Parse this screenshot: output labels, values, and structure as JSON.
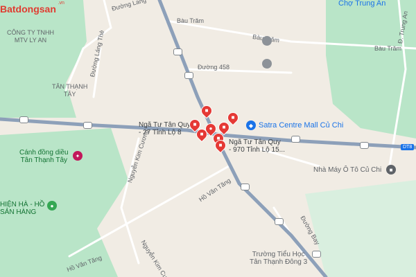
{
  "brand": {
    "name": "Batdongsan",
    "suffix": ".vn"
  },
  "colors": {
    "land": "#f1ece4",
    "park": "#b9e5c8",
    "highway": "#8da0b9",
    "road": "#ffffff",
    "poi_red": "#e53935",
    "poi_blue": "#1a73e8",
    "poi_green": "#34a853",
    "poi_gray": "#5f6368"
  },
  "labels": {
    "duong_lang": "Đường Lang",
    "bau_tram_1": "Bàu Trăm",
    "bau_tram_2": "Bàu Trăm",
    "bau_tram_3": "Bàu Trăm",
    "duong_458": "Đường 458",
    "lang_the": "Đường Láng Thè",
    "cong_ty_1": "CÔNG TY TNHH",
    "cong_ty_2": "MTV LY AN",
    "tan_thanh_1": "TÂN THẠNH",
    "tan_thanh_2": "TÂY",
    "nga_tu_1a": "Ngã Tư Tân Quy",
    "nga_tu_1b": "- 27 Tỉnh Lộ 8",
    "nga_tu_2a": "Ngã Tư Tân Quy",
    "nga_tu_2b": "- 970 Tỉnh Lộ 15...",
    "satra": "Satra Centre Mall Củ Chi",
    "canh_dong_1": "Cánh đồng diều",
    "canh_dong_2": "Tân Thạnh Tây",
    "nguyen_kim_cuong_1": "Nguyễn Kim Cương",
    "nguyen_kim_cuong_2": "Nguyễn Kim Cương",
    "ho_van_tang_1": "Hồ Văn Tăng",
    "ho_van_tang_2": "Hồ Văn Tăng",
    "hien_ha_1": "HIỆN HÀ - HỒ",
    "hien_ha_2": "SẢN HÀNG",
    "cho_trung_an": "Chợ Trung An",
    "duong_trung_an": "Đ. Trung An",
    "nha_may": "Nhà Máy Ô Tô Củ Chi",
    "truong_1": "Trường Tiểu Học",
    "truong_2": "Tân Thạnh Đông 3",
    "duong_bay": "Đường Bay",
    "dt8": "DT8"
  },
  "icons": {
    "poi_pin": "map-pin-icon",
    "bus": "bus-stop-icon",
    "shopping": "shopping-bag-icon",
    "kite": "kite-icon",
    "school": "school-icon",
    "factory": "factory-icon",
    "market": "market-icon"
  }
}
